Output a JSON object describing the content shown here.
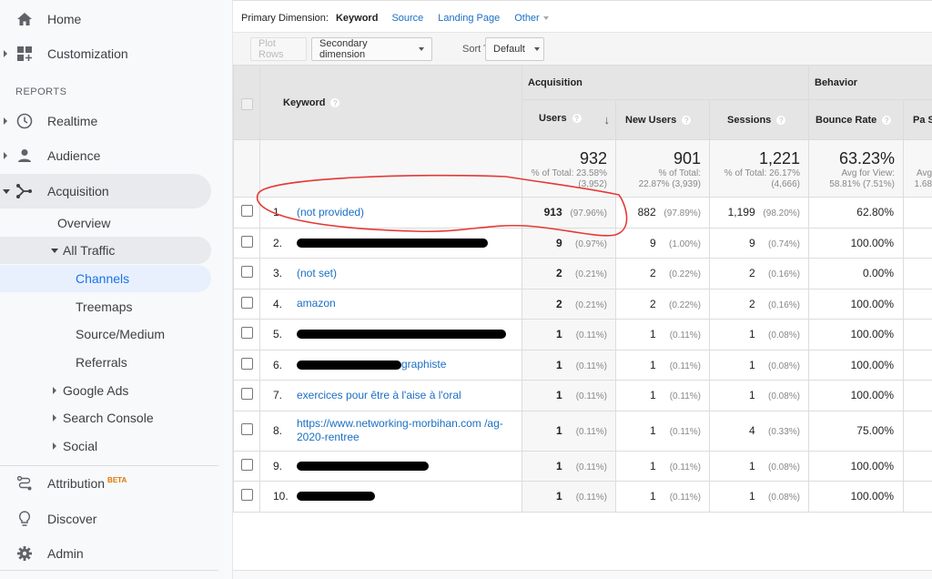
{
  "sidebar": {
    "home": "Home",
    "customization": "Customization",
    "reports_section": "REPORTS",
    "realtime": "Realtime",
    "audience": "Audience",
    "acquisition": "Acquisition",
    "acq_sub": {
      "overview": "Overview",
      "all_traffic": "All Traffic",
      "channels": "Channels",
      "treemaps": "Treemaps",
      "source_medium": "Source/Medium",
      "referrals": "Referrals",
      "google_ads": "Google Ads",
      "search_console": "Search Console",
      "social": "Social"
    },
    "attribution": "Attribution",
    "attribution_badge": "BETA",
    "discover": "Discover",
    "admin": "Admin"
  },
  "primary_dimension": {
    "label": "Primary Dimension:",
    "active": "Keyword",
    "options": [
      "Source",
      "Landing Page",
      "Other"
    ]
  },
  "toolbar": {
    "plot_rows": "Plot Rows",
    "secondary_dimension": "Secondary dimension",
    "sort_type_label": "Sort Type:",
    "sort_type_value": "Default"
  },
  "table": {
    "groups": {
      "acquisition": "Acquisition",
      "behavior": "Behavior"
    },
    "columns": {
      "keyword": "Keyword",
      "users": "Users",
      "new_users": "New Users",
      "sessions": "Sessions",
      "bounce_rate": "Bounce Rate",
      "pages_session_partial": "Pa Sess"
    },
    "help_glyph": "?",
    "sort_glyph": "↓",
    "totals": {
      "users": "932",
      "users_sub1": "% of Total: 23.58%",
      "users_sub2": "(3,952)",
      "new_users": "901",
      "new_users_sub1": "% of Total:",
      "new_users_sub2": "22.87% (3,939)",
      "sessions": "1,221",
      "sessions_sub1": "% of Total: 26.17%",
      "sessions_sub2": "(4,666)",
      "bounce_rate": "63.23%",
      "bounce_rate_sub1": "Avg for View:",
      "bounce_rate_sub2": "58.81% (7.51%)",
      "pages_sub1": "Avg",
      "pages_sub2": "1.68"
    },
    "rows": [
      {
        "idx": "1.",
        "keyword": "(not provided)",
        "redacted": false,
        "users": "913",
        "users_pct": "(97.96%)",
        "new_users": "882",
        "new_users_pct": "(97.89%)",
        "sessions": "1,199",
        "sessions_pct": "(98.20%)",
        "bounce": "62.80%"
      },
      {
        "idx": "2.",
        "keyword": "",
        "redacted": true,
        "users": "9",
        "users_pct": "(0.97%)",
        "new_users": "9",
        "new_users_pct": "(1.00%)",
        "sessions": "9",
        "sessions_pct": "(0.74%)",
        "bounce": "100.00%"
      },
      {
        "idx": "3.",
        "keyword": "(not set)",
        "redacted": false,
        "users": "2",
        "users_pct": "(0.21%)",
        "new_users": "2",
        "new_users_pct": "(0.22%)",
        "sessions": "2",
        "sessions_pct": "(0.16%)",
        "bounce": "0.00%"
      },
      {
        "idx": "4.",
        "keyword": "amazon",
        "redacted": false,
        "users": "2",
        "users_pct": "(0.21%)",
        "new_users": "2",
        "new_users_pct": "(0.22%)",
        "sessions": "2",
        "sessions_pct": "(0.16%)",
        "bounce": "100.00%"
      },
      {
        "idx": "5.",
        "keyword": "",
        "redacted": true,
        "users": "1",
        "users_pct": "(0.11%)",
        "new_users": "1",
        "new_users_pct": "(0.11%)",
        "sessions": "1",
        "sessions_pct": "(0.08%)",
        "bounce": "100.00%"
      },
      {
        "idx": "6.",
        "keyword": "graphiste",
        "redacted": true,
        "users": "1",
        "users_pct": "(0.11%)",
        "new_users": "1",
        "new_users_pct": "(0.11%)",
        "sessions": "1",
        "sessions_pct": "(0.08%)",
        "bounce": "100.00%"
      },
      {
        "idx": "7.",
        "keyword": "exercices pour être à l'aise à l'oral",
        "redacted": false,
        "users": "1",
        "users_pct": "(0.11%)",
        "new_users": "1",
        "new_users_pct": "(0.11%)",
        "sessions": "1",
        "sessions_pct": "(0.08%)",
        "bounce": "100.00%"
      },
      {
        "idx": "8.",
        "keyword": "https://www.networking-morbihan.com /ag-2020-rentree",
        "redacted": false,
        "users": "1",
        "users_pct": "(0.11%)",
        "new_users": "1",
        "new_users_pct": "(0.11%)",
        "sessions": "4",
        "sessions_pct": "(0.33%)",
        "bounce": "75.00%"
      },
      {
        "idx": "9.",
        "keyword": "",
        "redacted": true,
        "users": "1",
        "users_pct": "(0.11%)",
        "new_users": "1",
        "new_users_pct": "(0.11%)",
        "sessions": "1",
        "sessions_pct": "(0.08%)",
        "bounce": "100.00%"
      },
      {
        "idx": "10.",
        "keyword": "",
        "redacted": true,
        "users": "1",
        "users_pct": "(0.11%)",
        "new_users": "1",
        "new_users_pct": "(0.11%)",
        "sessions": "1",
        "sessions_pct": "(0.08%)",
        "bounce": "100.00%"
      }
    ]
  },
  "colors": {
    "link": "#1a6fc4",
    "active_nav": "#1a73e8",
    "annotation": "#e53935",
    "beta": "#e37400"
  }
}
